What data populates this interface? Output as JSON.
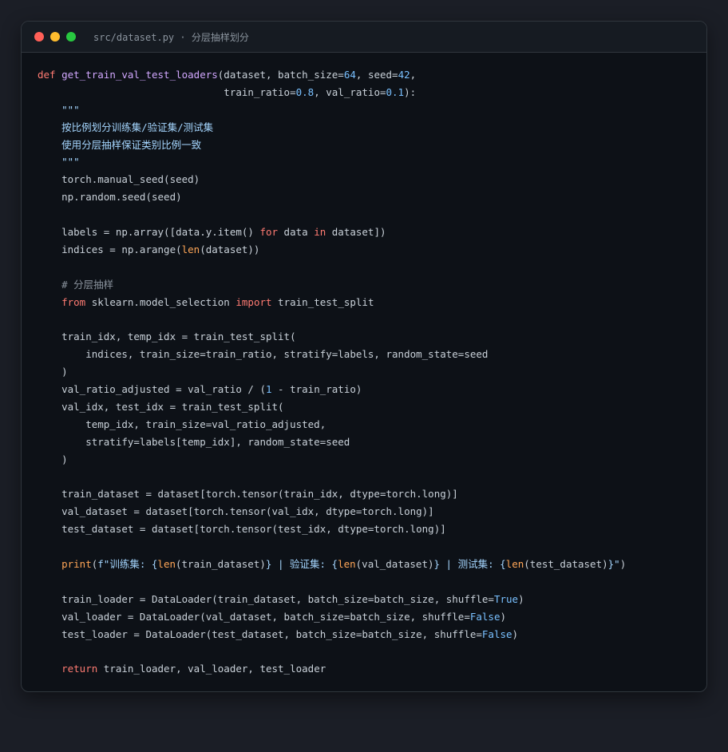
{
  "window": {
    "title": "src/dataset.py · 分层抽样划分",
    "traffic_lights": [
      {
        "name": "close-dot",
        "color": "#ff5f57"
      },
      {
        "name": "minimize-dot",
        "color": "#febc2e"
      },
      {
        "name": "maximize-dot",
        "color": "#28c840"
      }
    ]
  },
  "code_lines": [
    [
      [
        "kw",
        "def"
      ],
      [
        "plain",
        " "
      ],
      [
        "fn",
        "get_train_val_test_loaders"
      ],
      [
        "plain",
        "(dataset, batch_size="
      ],
      [
        "num",
        "64"
      ],
      [
        "plain",
        ", seed="
      ],
      [
        "num",
        "42"
      ],
      [
        "plain",
        ","
      ]
    ],
    [
      [
        "plain",
        "                               train_ratio="
      ],
      [
        "num",
        "0.8"
      ],
      [
        "plain",
        ", val_ratio="
      ],
      [
        "num",
        "0.1"
      ],
      [
        "plain",
        "):"
      ]
    ],
    [
      [
        "str",
        "    \"\"\""
      ]
    ],
    [
      [
        "str",
        "    按比例划分训练集/验证集/测试集"
      ]
    ],
    [
      [
        "str",
        "    使用分层抽样保证类别比例一致"
      ]
    ],
    [
      [
        "str",
        "    \"\"\""
      ]
    ],
    [
      [
        "plain",
        "    torch.manual_seed(seed)"
      ]
    ],
    [
      [
        "plain",
        "    np.random.seed(seed)"
      ]
    ],
    [
      [
        "plain",
        ""
      ]
    ],
    [
      [
        "plain",
        "    labels = np.array([data.y.item() "
      ],
      [
        "kw",
        "for"
      ],
      [
        "plain",
        " data "
      ],
      [
        "kw",
        "in"
      ],
      [
        "plain",
        " dataset])"
      ]
    ],
    [
      [
        "plain",
        "    indices = np.arange("
      ],
      [
        "bi",
        "len"
      ],
      [
        "plain",
        "(dataset))"
      ]
    ],
    [
      [
        "plain",
        ""
      ]
    ],
    [
      [
        "cmt",
        "    # 分层抽样"
      ]
    ],
    [
      [
        "plain",
        "    "
      ],
      [
        "kw",
        "from"
      ],
      [
        "plain",
        " sklearn.model_selection "
      ],
      [
        "kw",
        "import"
      ],
      [
        "plain",
        " train_test_split"
      ]
    ],
    [
      [
        "plain",
        ""
      ]
    ],
    [
      [
        "plain",
        "    train_idx, temp_idx = train_test_split("
      ]
    ],
    [
      [
        "plain",
        "        indices, train_size=train_ratio, stratify=labels, random_state=seed"
      ]
    ],
    [
      [
        "plain",
        "    )"
      ]
    ],
    [
      [
        "plain",
        "    val_ratio_adjusted = val_ratio / ("
      ],
      [
        "num",
        "1"
      ],
      [
        "plain",
        " - train_ratio)"
      ]
    ],
    [
      [
        "plain",
        "    val_idx, test_idx = train_test_split("
      ]
    ],
    [
      [
        "plain",
        "        temp_idx, train_size=val_ratio_adjusted,"
      ]
    ],
    [
      [
        "plain",
        "        stratify=labels[temp_idx], random_state=seed"
      ]
    ],
    [
      [
        "plain",
        "    )"
      ]
    ],
    [
      [
        "plain",
        ""
      ]
    ],
    [
      [
        "plain",
        "    train_dataset = dataset[torch.tensor(train_idx, dtype=torch.long)]"
      ]
    ],
    [
      [
        "plain",
        "    val_dataset = dataset[torch.tensor(val_idx, dtype=torch.long)]"
      ]
    ],
    [
      [
        "plain",
        "    test_dataset = dataset[torch.tensor(test_idx, dtype=torch.long)]"
      ]
    ],
    [
      [
        "plain",
        ""
      ]
    ],
    [
      [
        "plain",
        "    "
      ],
      [
        "bi",
        "print"
      ],
      [
        "plain",
        "("
      ],
      [
        "str",
        "f\"训练集: {"
      ],
      [
        "bi",
        "len"
      ],
      [
        "plain",
        "(train_dataset)"
      ],
      [
        "str",
        "} | 验证集: {"
      ],
      [
        "bi",
        "len"
      ],
      [
        "plain",
        "(val_dataset)"
      ],
      [
        "str",
        "} | 测试集: {"
      ],
      [
        "bi",
        "len"
      ],
      [
        "plain",
        "(test_dataset)"
      ],
      [
        "str",
        "}\""
      ],
      [
        "plain",
        ")"
      ]
    ],
    [
      [
        "plain",
        ""
      ]
    ],
    [
      [
        "plain",
        "    train_loader = DataLoader(train_dataset, batch_size=batch_size, shuffle="
      ],
      [
        "num",
        "True"
      ],
      [
        "plain",
        ")"
      ]
    ],
    [
      [
        "plain",
        "    val_loader = DataLoader(val_dataset, batch_size=batch_size, shuffle="
      ],
      [
        "num",
        "False"
      ],
      [
        "plain",
        ")"
      ]
    ],
    [
      [
        "plain",
        "    test_loader = DataLoader(test_dataset, batch_size=batch_size, shuffle="
      ],
      [
        "num",
        "False"
      ],
      [
        "plain",
        ")"
      ]
    ],
    [
      [
        "plain",
        ""
      ]
    ],
    [
      [
        "plain",
        "    "
      ],
      [
        "kw",
        "return"
      ],
      [
        "plain",
        " train_loader, val_loader, test_loader"
      ]
    ]
  ]
}
